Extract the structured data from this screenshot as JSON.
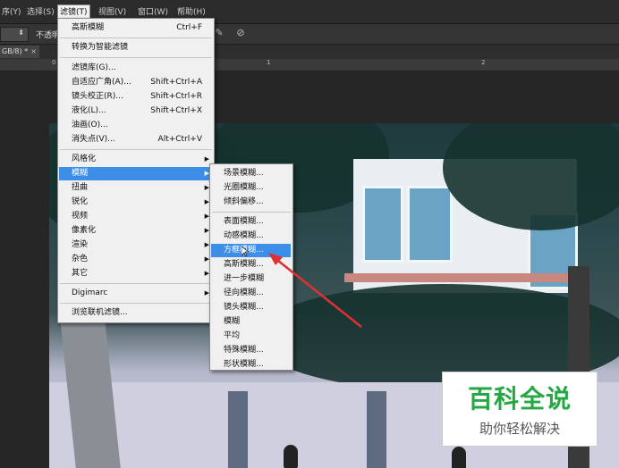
{
  "menubar": {
    "items": [
      "序(Y)",
      "选择(S)",
      "滤镜(T)",
      "视图(V)",
      "窗口(W)",
      "帮助(H)"
    ]
  },
  "options": {
    "opacity_label": "不透明"
  },
  "doc_tab": {
    "label": "GB/8) *",
    "close": "×"
  },
  "ruler": {
    "ticks": [
      "0",
      "1",
      "2"
    ]
  },
  "filter_menu": {
    "items": [
      {
        "label": "高斯模糊",
        "shortcut": "Ctrl+F"
      },
      {
        "label": "转换为智能滤镜",
        "shortcut": ""
      },
      {
        "label": "滤镜库(G)...",
        "shortcut": ""
      },
      {
        "label": "自适应广角(A)...",
        "shortcut": "Shift+Ctrl+A"
      },
      {
        "label": "镜头校正(R)...",
        "shortcut": "Shift+Ctrl+R"
      },
      {
        "label": "液化(L)...",
        "shortcut": "Shift+Ctrl+X"
      },
      {
        "label": "油画(O)...",
        "shortcut": ""
      },
      {
        "label": "消失点(V)...",
        "shortcut": "Alt+Ctrl+V"
      },
      {
        "label": "风格化",
        "shortcut": ""
      },
      {
        "label": "模糊",
        "shortcut": ""
      },
      {
        "label": "扭曲",
        "shortcut": ""
      },
      {
        "label": "锐化",
        "shortcut": ""
      },
      {
        "label": "视频",
        "shortcut": ""
      },
      {
        "label": "像素化",
        "shortcut": ""
      },
      {
        "label": "渲染",
        "shortcut": ""
      },
      {
        "label": "杂色",
        "shortcut": ""
      },
      {
        "label": "其它",
        "shortcut": ""
      },
      {
        "label": "Digimarc",
        "shortcut": ""
      },
      {
        "label": "浏览联机滤镜...",
        "shortcut": ""
      }
    ],
    "submenu_arrow": "▶"
  },
  "blur_menu": {
    "items": [
      "场景模糊...",
      "光圈模糊...",
      "倾斜偏移...",
      "表面模糊...",
      "动感模糊...",
      "方框模糊...",
      "高斯模糊...",
      "进一步模糊",
      "径向模糊...",
      "镜头模糊...",
      "模糊",
      "平均",
      "特殊模糊...",
      "形状模糊..."
    ],
    "highlighted": "方框模糊..."
  },
  "watermark": {
    "title": "百科全说",
    "subtitle": "助你轻松解决"
  },
  "colors": {
    "highlight": "#3d8ee6",
    "annotation_arrow": "#e03030",
    "watermark_green": "#25a744"
  }
}
